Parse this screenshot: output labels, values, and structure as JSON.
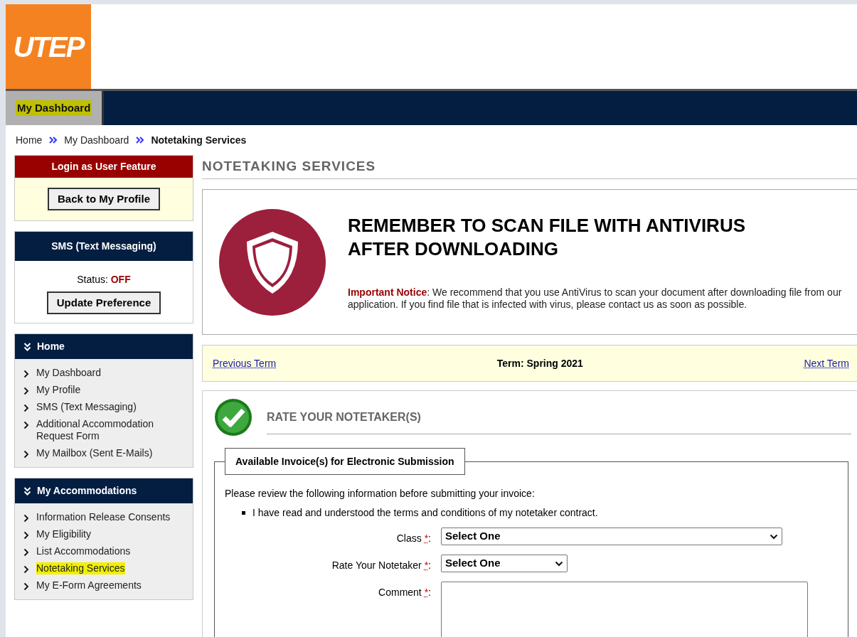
{
  "header": {
    "logo": "UTEP"
  },
  "nav_tabs": [
    {
      "label": "My Dashboard",
      "selected": true,
      "highlighted": true
    }
  ],
  "breadcrumb": [
    {
      "label": "Home",
      "current": false
    },
    {
      "label": "My Dashboard",
      "current": false
    },
    {
      "label": "Notetaking Services",
      "current": true
    }
  ],
  "sidebar": {
    "login_panel": {
      "title": "Login as User Feature",
      "button": "Back to My Profile"
    },
    "sms_panel": {
      "title": "SMS (Text Messaging)",
      "status_label": "Status:",
      "status_value": "OFF",
      "on": false,
      "button": "Update Preference"
    },
    "menus": [
      {
        "title": "Home",
        "items": [
          {
            "label": "My Dashboard",
            "highlighted": false
          },
          {
            "label": "My Profile",
            "highlighted": false
          },
          {
            "label": "SMS (Text Messaging)",
            "highlighted": false
          },
          {
            "label": "Additional Accommodation Request Form",
            "highlighted": false
          },
          {
            "label": "My Mailbox (Sent E-Mails)",
            "highlighted": false
          }
        ]
      },
      {
        "title": "My Accommodations",
        "items": [
          {
            "label": "Information Release Consents",
            "highlighted": false
          },
          {
            "label": "My Eligibility",
            "highlighted": false
          },
          {
            "label": "List Accommodations",
            "highlighted": false
          },
          {
            "label": "Notetaking Services",
            "highlighted": true
          },
          {
            "label": "My E-Form Agreements",
            "highlighted": false
          }
        ]
      }
    ]
  },
  "main": {
    "title": "NOTETAKING SERVICES",
    "notice": {
      "heading": "REMEMBER TO SCAN FILE WITH ANTIVIRUS AFTER DOWNLOADING",
      "label": "Important Notice",
      "text": ": We recommend that you use AntiVirus to scan your document after downloading file from our application. If you find file that is infected with virus, please contact us as soon as possible."
    },
    "term_bar": {
      "previous": "Previous Term",
      "term": "Term: Spring 2021",
      "next": "Next Term"
    },
    "section": {
      "title": "RATE YOUR NOTETAKER(S)",
      "fieldset": {
        "legend": "Available Invoice(s) for Electronic Submission",
        "intro": "Please review the following information before submitting your invoice:",
        "bullets": [
          "I have read and understood the terms and conditions of my notetaker contract."
        ],
        "fields": [
          {
            "label": "Class",
            "required": "*",
            "suffix": ":",
            "kind": "long_select",
            "value": "Select One"
          },
          {
            "label": "Rate Your Notetaker",
            "required": "*",
            "suffix": ":",
            "kind": "short_select",
            "value": "Select One"
          },
          {
            "label": "Comment",
            "required": "*",
            "suffix": ":",
            "kind": "textarea"
          }
        ]
      }
    }
  }
}
